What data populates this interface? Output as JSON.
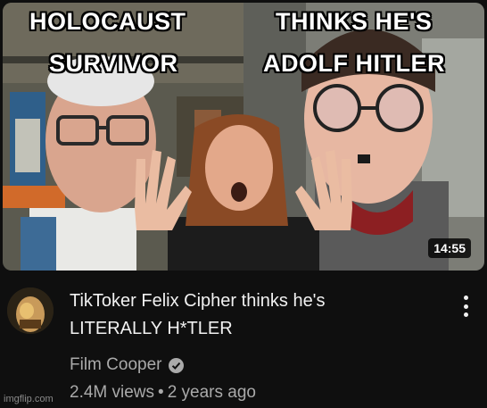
{
  "thumbnail": {
    "caption_left_line1": "HOLOCAUST",
    "caption_left_line2": "SURVIVOR",
    "caption_right_line1": "THINKS HE'S",
    "caption_right_line2": "ADOLF HITLER",
    "duration": "14:55"
  },
  "video": {
    "title_line1": "TikToker Felix Cipher thinks he's",
    "title_line2": "LITERALLY H*TLER",
    "channel": "Film Cooper",
    "views": "2.4M views",
    "separator": "•",
    "age": "2 years ago"
  },
  "icons": {
    "verified": "check-circle-icon",
    "menu": "more-vert-icon"
  },
  "watermark": "imgflip.com",
  "colors": {
    "background": "#0f0f0f",
    "title": "#f1f1f1",
    "secondary_text": "#aaaaaa"
  }
}
